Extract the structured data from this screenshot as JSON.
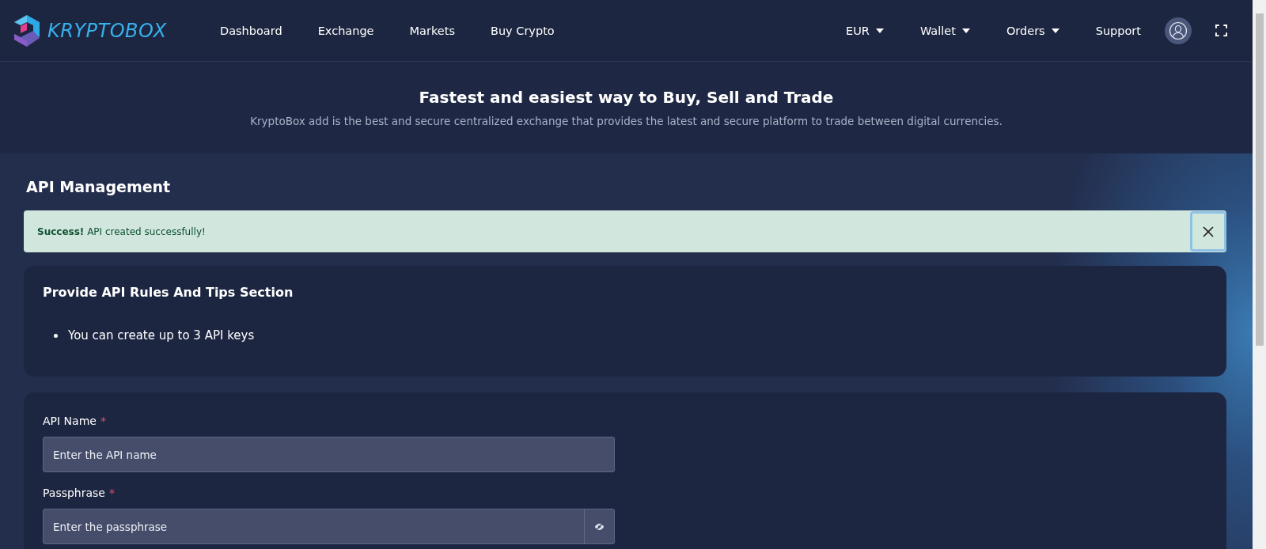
{
  "header": {
    "logo": "KRYPTOBOX",
    "nav": [
      {
        "label": "Dashboard"
      },
      {
        "label": "Exchange"
      },
      {
        "label": "Markets"
      },
      {
        "label": "Buy Crypto"
      }
    ],
    "right_menu": [
      {
        "label": "EUR",
        "dropdown": true
      },
      {
        "label": "Wallet",
        "dropdown": true
      },
      {
        "label": "Orders",
        "dropdown": true
      },
      {
        "label": "Support",
        "dropdown": false
      }
    ]
  },
  "hero": {
    "title": "Fastest and easiest way to Buy, Sell and Trade",
    "subtitle": "KryptoBox add is the best and secure centralized exchange that provides the latest and secure platform to trade between digital currencies."
  },
  "page_title": "API Management",
  "alert": {
    "text": "**Success!** API created successfully!"
  },
  "tips": {
    "title": "Provide API Rules And Tips Section",
    "items": [
      "You can create up to 3 API keys"
    ]
  },
  "form": {
    "fields": [
      {
        "kind": "text",
        "label": "API Name",
        "required_mark": "*",
        "placeholder": "Enter the API name"
      },
      {
        "kind": "password",
        "label": "Passphrase",
        "required_mark": "*",
        "placeholder": "Enter the passphrase"
      }
    ]
  }
}
